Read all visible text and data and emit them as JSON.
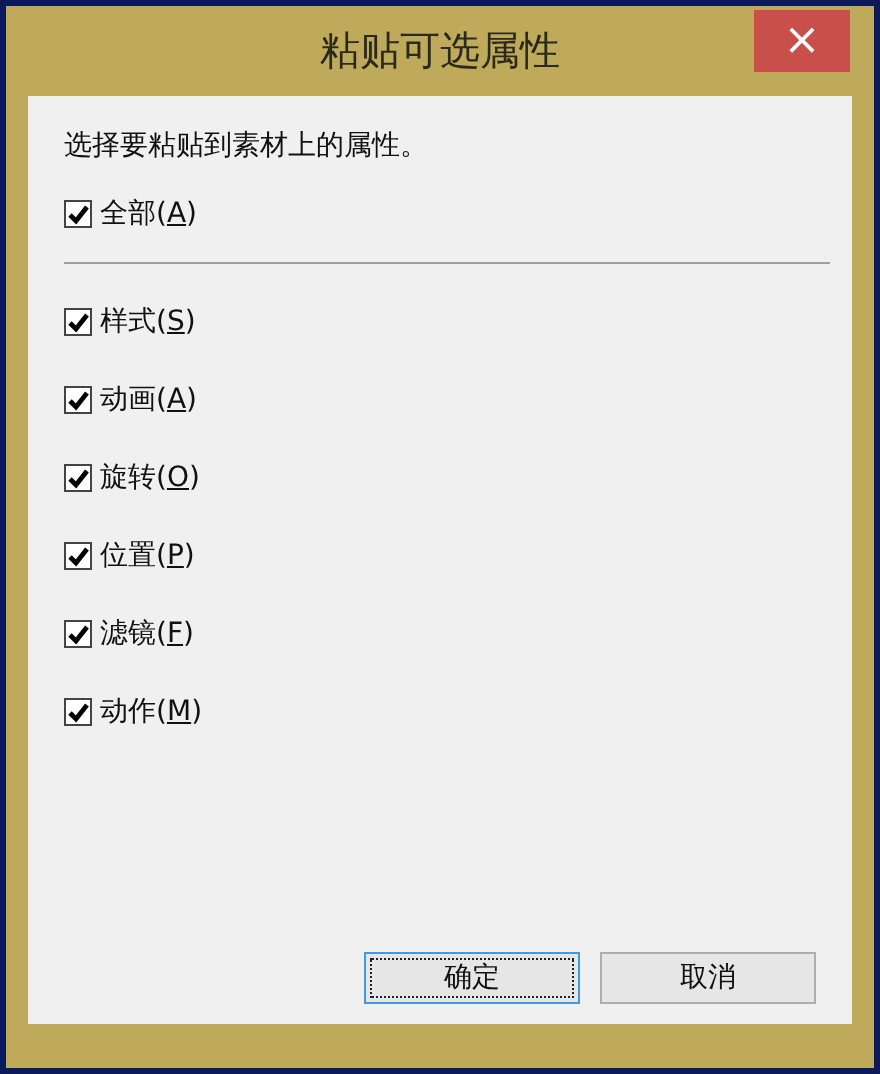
{
  "window": {
    "title": "粘贴可选属性",
    "close": "×"
  },
  "instruction": "选择要粘贴到素材上的属性。",
  "all": {
    "before": "全部(",
    "key": "A",
    "after": ")",
    "checked": true
  },
  "options": [
    {
      "before": "样式(",
      "key": "S",
      "after": ")",
      "checked": true
    },
    {
      "before": "动画(",
      "key": "A",
      "after": ")",
      "checked": true
    },
    {
      "before": "旋转(",
      "key": "O",
      "after": ")",
      "checked": true
    },
    {
      "before": "位置(",
      "key": "P",
      "after": ")",
      "checked": true
    },
    {
      "before": "滤镜(",
      "key": "F",
      "after": ")",
      "checked": true
    },
    {
      "before": "动作(",
      "key": "M",
      "after": ")",
      "checked": true
    }
  ],
  "buttons": [
    {
      "label": "确定",
      "default": true
    },
    {
      "label": "取消",
      "default": false
    }
  ]
}
